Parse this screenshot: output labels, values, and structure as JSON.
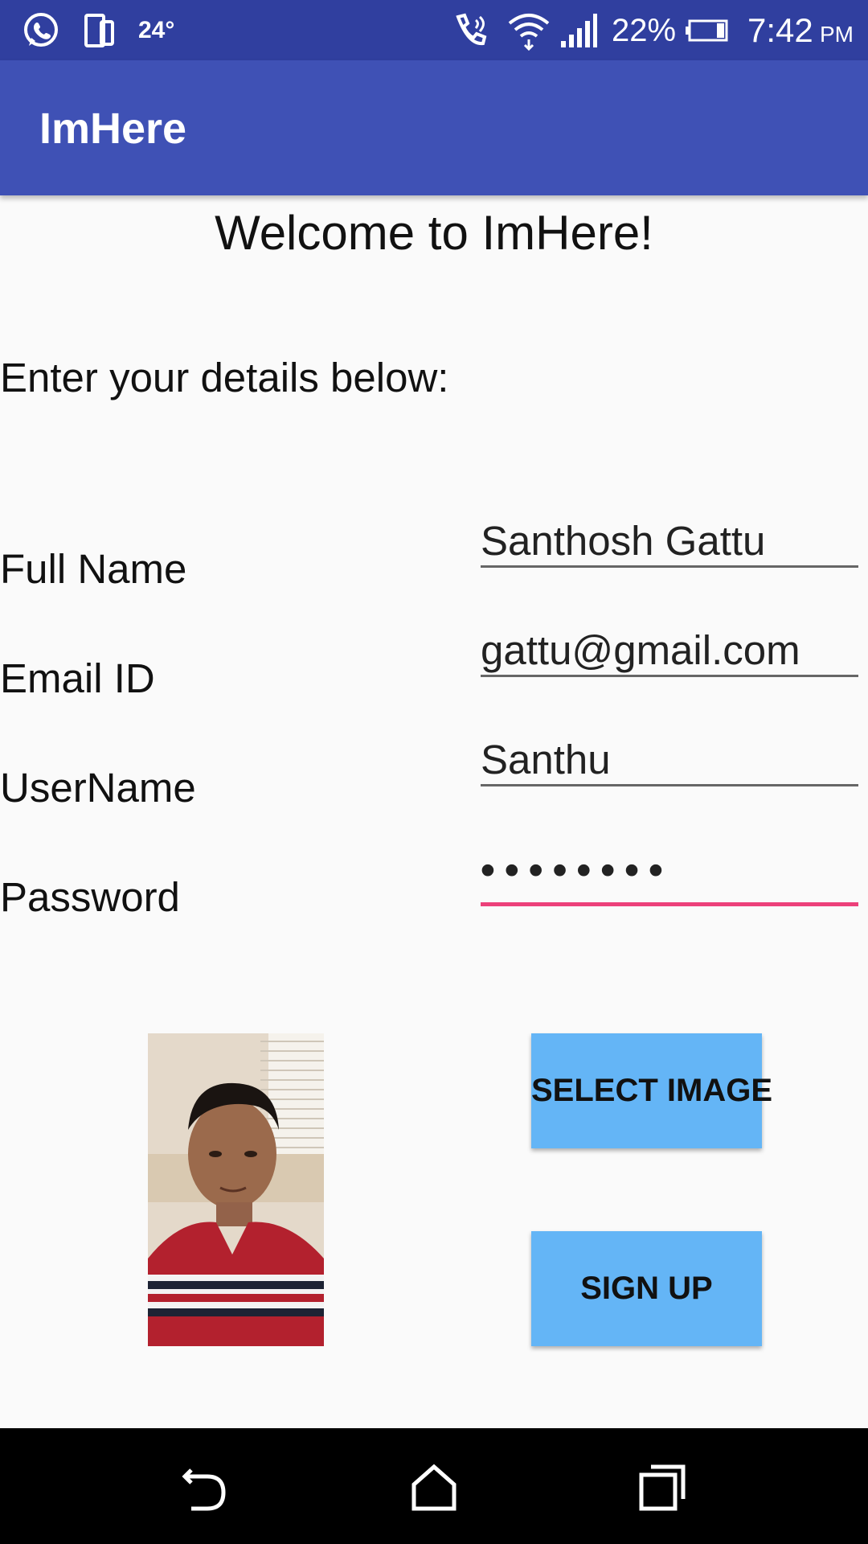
{
  "status_bar": {
    "temperature": "24°",
    "battery": "22%",
    "time": "7:42",
    "ampm": "PM",
    "icons": [
      "whatsapp-icon",
      "device-icon",
      "wifi-call-icon",
      "wifi-icon",
      "signal-icon",
      "battery-icon"
    ]
  },
  "app_bar": {
    "title": "ImHere"
  },
  "main": {
    "welcome": "Welcome to ImHere!",
    "instructions": "Enter your details below:",
    "fields": {
      "full_name": {
        "label": "Full Name",
        "value": "Santhosh Gattu"
      },
      "email": {
        "label": "Email ID",
        "value": "gattu@gmail.com"
      },
      "username": {
        "label": "UserName",
        "value": "Santhu"
      },
      "password": {
        "label": "Password",
        "value": "••••••••"
      }
    },
    "buttons": {
      "select_image": "SELECT IMAGE",
      "sign_up": "SIGN UP"
    },
    "accent_color": "#ec407a",
    "button_color": "#64b5f6"
  },
  "nav_bar": {
    "icons": [
      "back-icon",
      "home-icon",
      "recents-icon"
    ]
  },
  "colors": {
    "status_bar": "#303f9f",
    "app_bar": "#3f51b5"
  }
}
